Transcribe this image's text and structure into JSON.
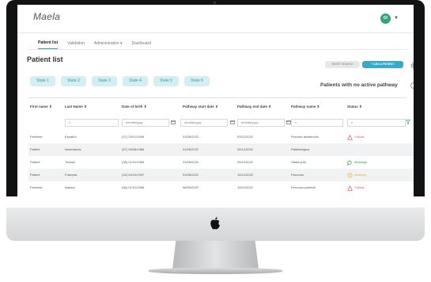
{
  "app": {
    "brand": "Maela",
    "user_initials": "DI"
  },
  "nav": {
    "tabs": [
      "Patient list",
      "Validation",
      "Administration ▾",
      "Dashboard"
    ]
  },
  "page": {
    "title": "Patient list",
    "reset_label": "RESET SEARCH",
    "add_label": "+ ADD A PATIENT",
    "no_pathway_label": "Patients with no active pathway"
  },
  "states": [
    "State 1",
    "State 2",
    "State 3",
    "State 4",
    "State 5",
    "State 6"
  ],
  "table": {
    "columns": [
      "First name ⇕",
      "Last Name ⇕",
      "Date of birth ⇕",
      "Pathway start date ⇕",
      "Pathway end date ⇕",
      "Pathway name ⇕",
      "Status ⇕"
    ],
    "date_placeholder": "mm/dd/yyyy",
    "rows": [
      {
        "first": "Paciente",
        "last": "Español",
        "dob": "(27) 29/11/1996",
        "start": "31/05/2022",
        "end": "03/12/2022",
        "pathway": "Proceso asistencial",
        "status": "Critical",
        "status_color": "#e15759",
        "status_icon": "warning-triangle-icon"
      },
      {
        "first": "Patiënt",
        "last": "Nederlands",
        "dob": "(57) 26/05/1965",
        "start": "31/05/2022",
        "end": "05/12/2022",
        "pathway": "Patiënttraject",
        "status": "",
        "status_color": "",
        "status_icon": ""
      },
      {
        "first": "Patient",
        "last": "Turkish",
        "dob": "(38) 01/01/1984",
        "start": "31/05/2022",
        "end": "09/12/2022",
        "pathway": "Hasta yolu",
        "status": "Message",
        "status_color": "#2fa84f",
        "status_icon": "message-bubble-icon"
      },
      {
        "first": "Patient",
        "last": "Français",
        "dob": "(24) 20/10/1997",
        "start": "01/06/2022",
        "end": "10/12/2022",
        "pathway": "Parcours",
        "status": "Warning",
        "status_color": "#f0a830",
        "status_icon": "warning-circle-icon"
      },
      {
        "first": "Paziente",
        "last": "Italiano",
        "dob": "(66) 01/01/1956",
        "start": "06/09/2022",
        "end": "10/12/2022",
        "pathway": "Percorso pazienti",
        "status": "Critical",
        "status_color": "#e15759",
        "status_icon": "warning-triangle-icon"
      }
    ]
  },
  "colors": {
    "accent": "#34a9d4",
    "state_pill_bg": "#d3eff1",
    "state_pill_text": "#2d9ea8",
    "avatar": "#1f9e6e"
  }
}
